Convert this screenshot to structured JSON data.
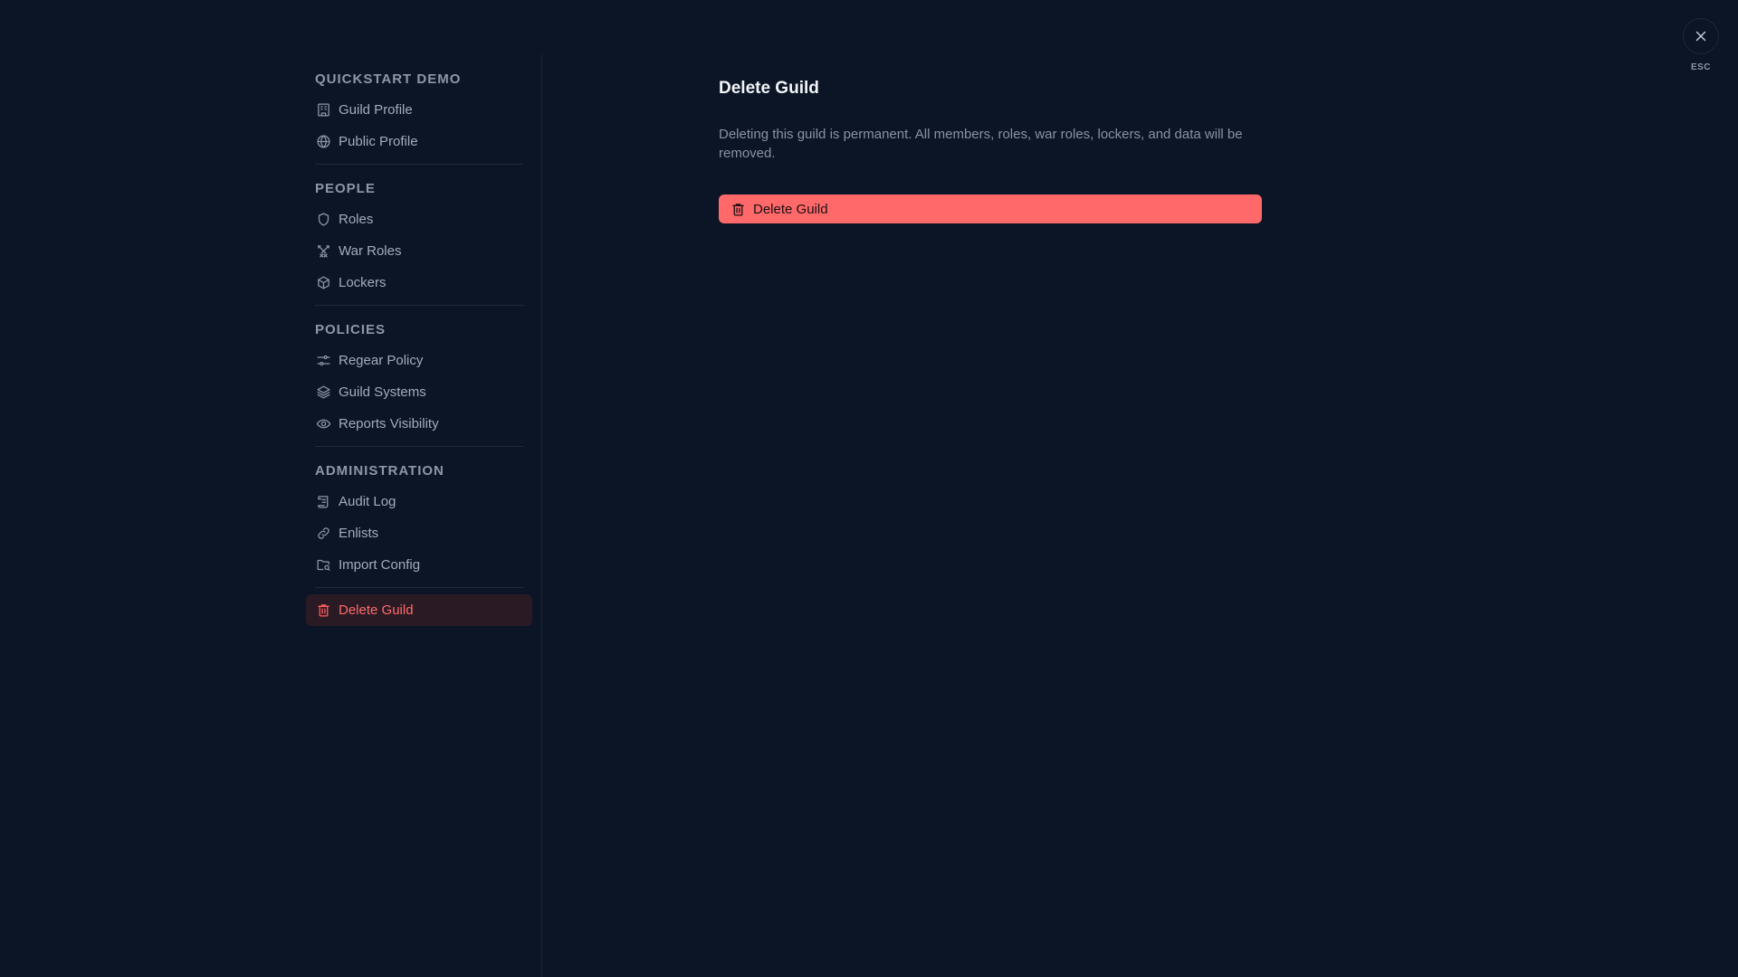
{
  "sidebar": {
    "sections": [
      {
        "title": "QUICKSTART DEMO",
        "items": [
          {
            "label": "Guild Profile",
            "icon": "building-icon"
          },
          {
            "label": "Public Profile",
            "icon": "globe-icon"
          }
        ]
      },
      {
        "title": "PEOPLE",
        "items": [
          {
            "label": "Roles",
            "icon": "shield-icon"
          },
          {
            "label": "War Roles",
            "icon": "crossed-swords-icon"
          },
          {
            "label": "Lockers",
            "icon": "box-icon"
          }
        ]
      },
      {
        "title": "POLICIES",
        "items": [
          {
            "label": "Regear Policy",
            "icon": "sliders-icon"
          },
          {
            "label": "Guild Systems",
            "icon": "layers-icon"
          },
          {
            "label": "Reports Visibility",
            "icon": "eye-icon"
          }
        ]
      },
      {
        "title": "ADMINISTRATION",
        "items": [
          {
            "label": "Audit Log",
            "icon": "scroll-icon"
          },
          {
            "label": "Enlists",
            "icon": "link-icon"
          },
          {
            "label": "Import Config",
            "icon": "folder-search-icon"
          }
        ]
      }
    ],
    "danger_item": {
      "label": "Delete Guild",
      "icon": "trash-icon",
      "color": "#ff6b6b"
    }
  },
  "main": {
    "title": "Delete Guild",
    "description": "Deleting this guild is permanent. All members, roles, war roles, lockers, and data will be removed.",
    "delete_button_label": "Delete Guild",
    "delete_button_color": "#ff6969"
  },
  "close": {
    "icon": "close-icon",
    "label": "ESC"
  },
  "colors": {
    "background": "#0b1526",
    "danger": "#ff6969"
  }
}
